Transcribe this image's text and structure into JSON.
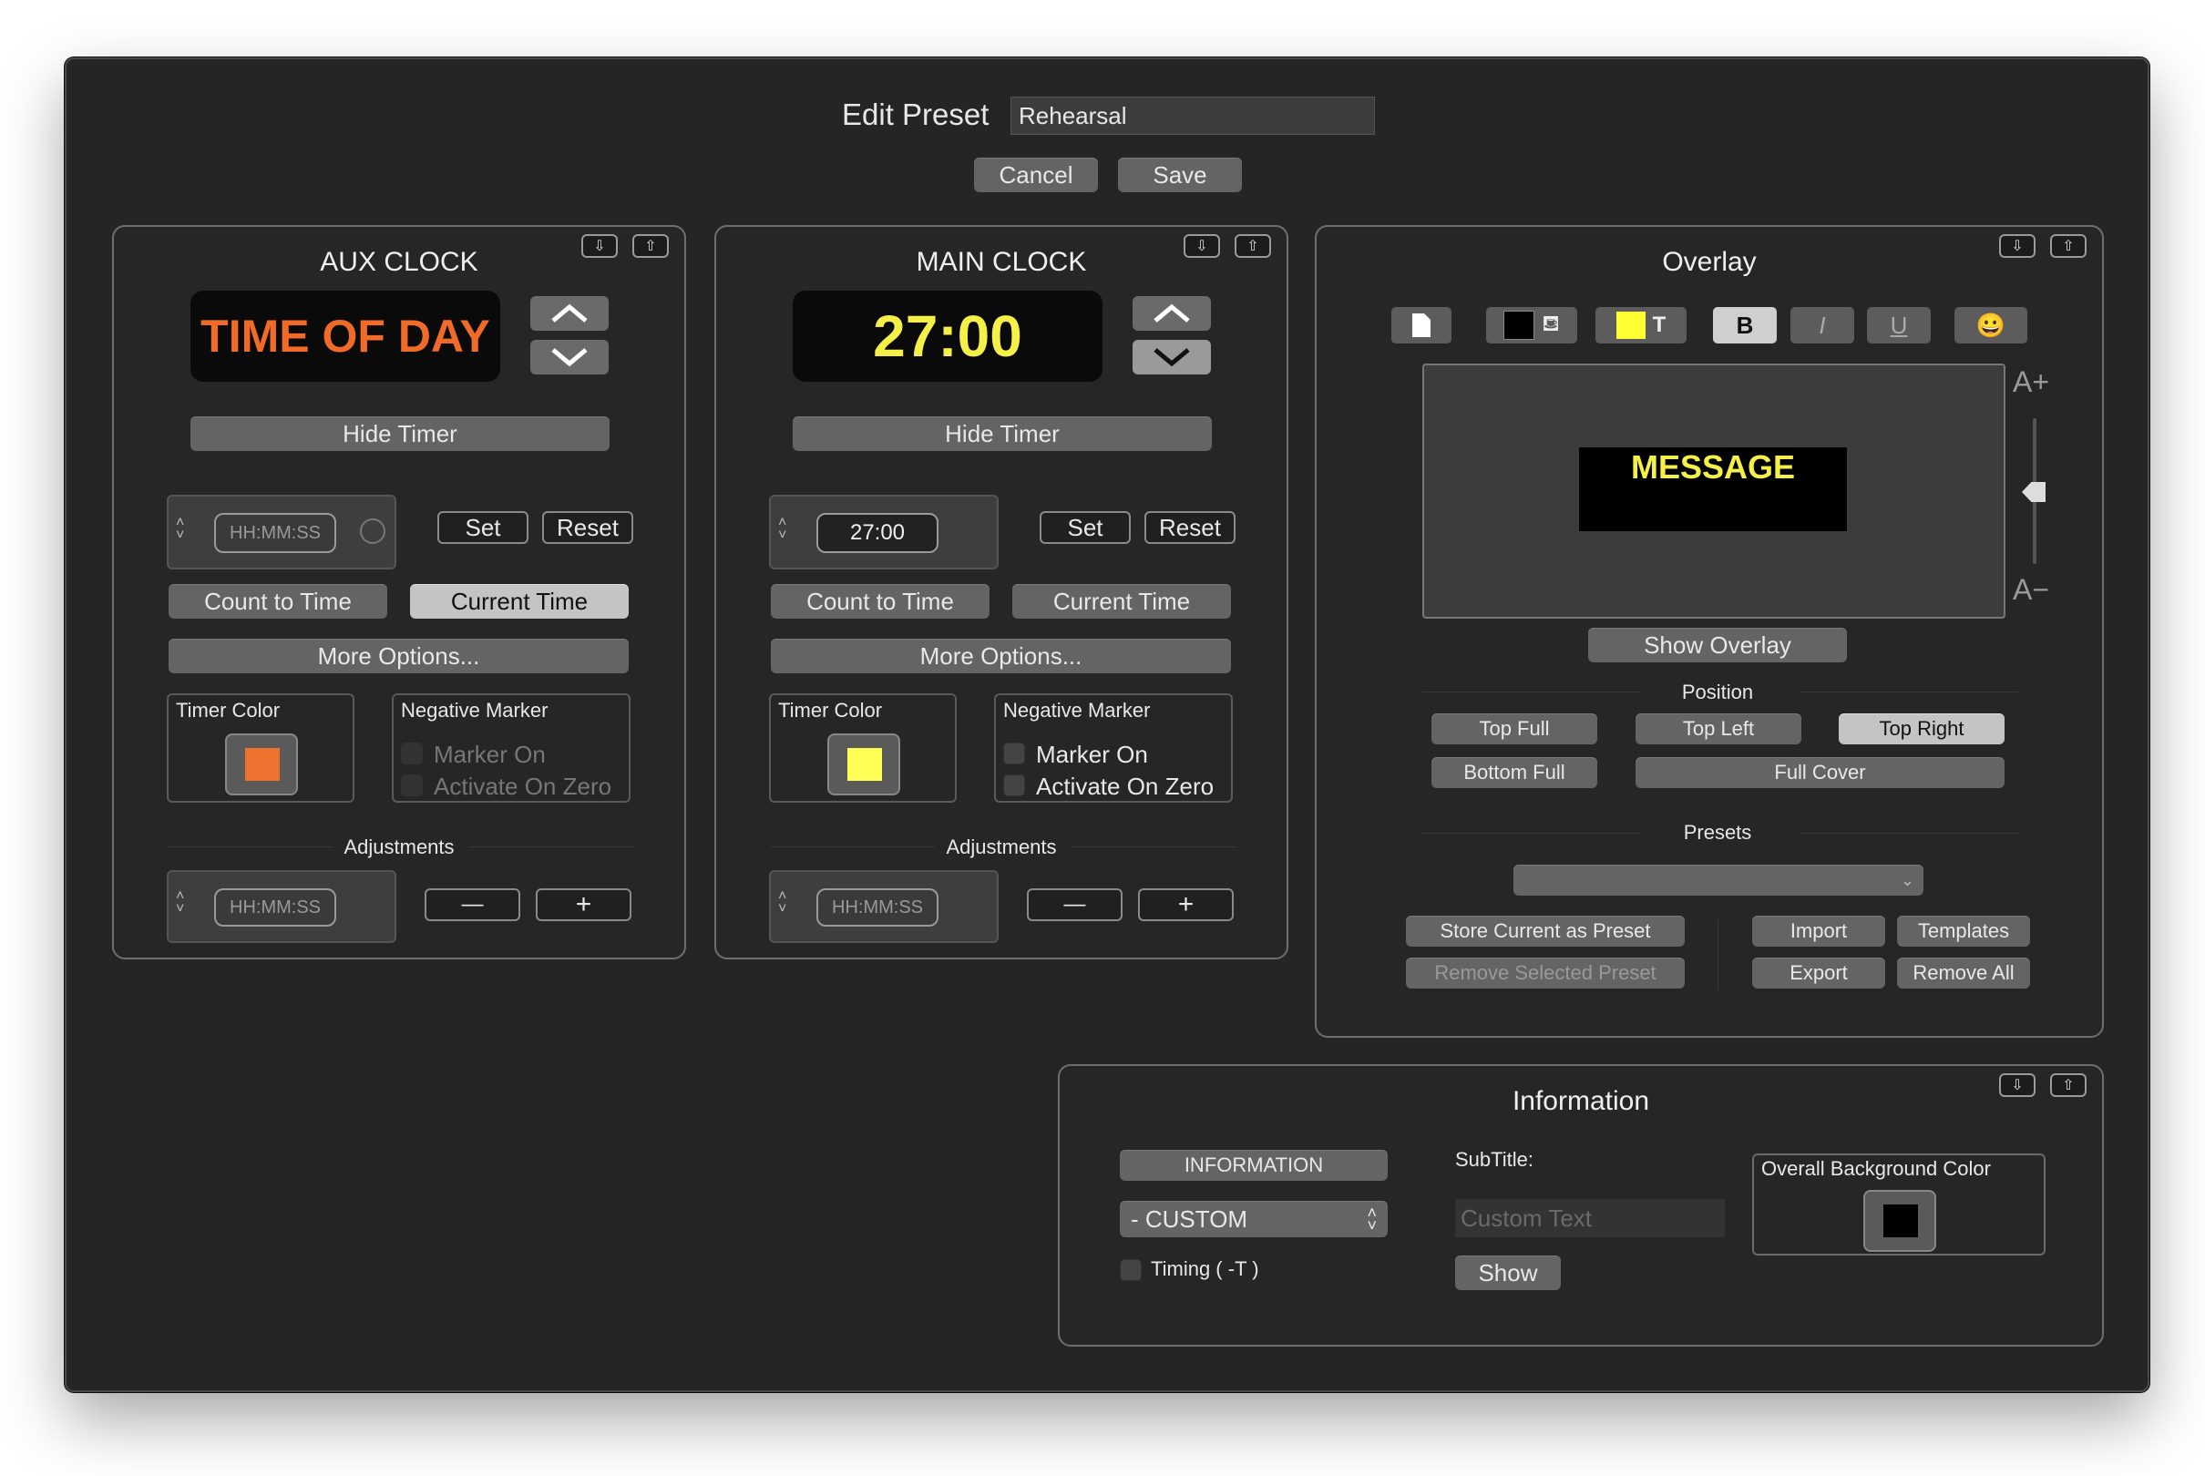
{
  "header": {
    "title": "Edit Preset",
    "preset_name": "Rehearsal",
    "cancel_label": "Cancel",
    "save_label": "Save"
  },
  "aux": {
    "title": "AUX CLOCK",
    "display_text": "TIME OF DAY",
    "display_color": "#f06a28",
    "hide_label": "Hide Timer",
    "time_placeholder": "HH:MM:SS",
    "set_label": "Set",
    "reset_label": "Reset",
    "count_label": "Count to Time",
    "current_label": "Current Time",
    "more_label": "More Options...",
    "timer_color_label": "Timer Color",
    "timer_color": "#f07030",
    "neg_label": "Negative Marker",
    "marker_on": "Marker On",
    "activate_zero": "Activate On Zero",
    "adjust_label": "Adjustments",
    "adjust_placeholder": "HH:MM:SS",
    "minus": "—",
    "plus": "+"
  },
  "main": {
    "title": "MAIN CLOCK",
    "display_text": "27:00",
    "display_color": "#f5f048",
    "hide_label": "Hide Timer",
    "time_value": "27:00",
    "set_label": "Set",
    "reset_label": "Reset",
    "count_label": "Count to Time",
    "current_label": "Current Time",
    "more_label": "More Options...",
    "timer_color_label": "Timer Color",
    "timer_color": "#ffff55",
    "neg_label": "Negative Marker",
    "marker_on": "Marker On",
    "activate_zero": "Activate On Zero",
    "adjust_label": "Adjustments",
    "adjust_placeholder": "HH:MM:SS",
    "minus": "—",
    "plus": "+"
  },
  "overlay": {
    "title": "Overlay",
    "message": "MESSAGE",
    "message_color": "#f5f048",
    "text_size_up": "A+",
    "text_size_down": "A−",
    "bold": "B",
    "italic": "I",
    "underline": "U",
    "emoji": "😀",
    "show_label": "Show Overlay",
    "position_label": "Position",
    "positions": [
      "Top Full",
      "Top Left",
      "Top Right",
      "Bottom Full",
      "Full Cover"
    ],
    "presets_label": "Presets",
    "store_label": "Store Current as Preset",
    "remove_sel_label": "Remove Selected Preset",
    "import_label": "Import",
    "templates_label": "Templates",
    "export_label": "Export",
    "remove_all_label": "Remove All"
  },
  "information": {
    "title": "Information",
    "info_button": "INFORMATION",
    "custom_select": "- CUSTOM",
    "timing_label": "Timing ( -T )",
    "subtitle_label": "SubTitle:",
    "custom_placeholder": "Custom Text",
    "show_label": "Show",
    "bg_color_label": "Overall Background Color",
    "bg_color": "#000000"
  }
}
